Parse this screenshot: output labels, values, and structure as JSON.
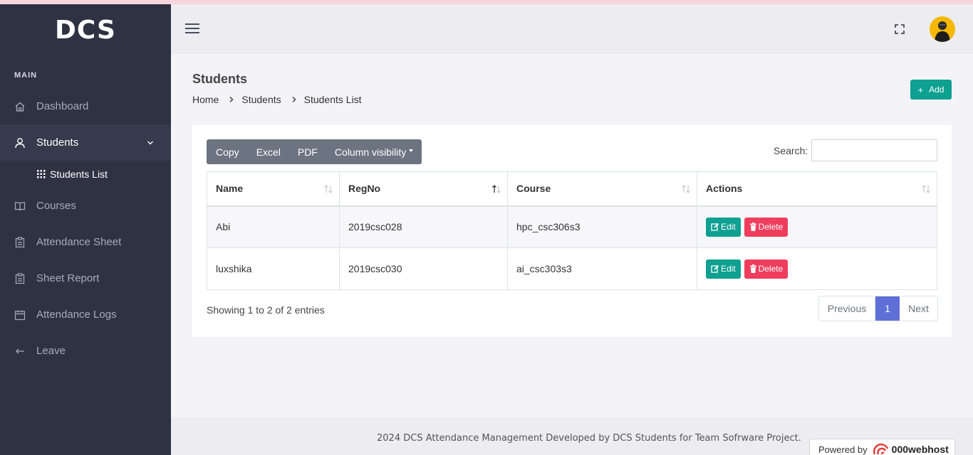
{
  "brand": "DCS",
  "sidebar": {
    "section_label": "MAIN",
    "items": [
      {
        "label": "Dashboard",
        "icon": "home-icon"
      },
      {
        "label": "Students",
        "icon": "user-icon"
      },
      {
        "label": "Courses",
        "icon": "book-icon"
      },
      {
        "label": "Attendance Sheet",
        "icon": "clipboard-icon"
      },
      {
        "label": "Sheet Report",
        "icon": "clipboard-icon"
      },
      {
        "label": "Attendance Logs",
        "icon": "calendar-icon"
      },
      {
        "label": "Leave",
        "icon": "arrow-left-icon"
      }
    ],
    "sub_item": "Students List"
  },
  "header": {
    "title": "Students",
    "breadcrumb": [
      "Home",
      "Students",
      "Students List"
    ],
    "add_label": "Add"
  },
  "toolbar": {
    "copy": "Copy",
    "excel": "Excel",
    "pdf": "PDF",
    "column_visibility": "Column visibility",
    "search_label": "Search:",
    "search_value": ""
  },
  "table": {
    "columns": [
      "Name",
      "RegNo",
      "Course",
      "Actions"
    ],
    "rows": [
      {
        "name": "Abi",
        "regno": "2019csc028",
        "course": "hpc_csc306s3"
      },
      {
        "name": "luxshika",
        "regno": "2019csc030",
        "course": "ai_csc303s3"
      }
    ],
    "edit_label": "Edit",
    "delete_label": "Delete"
  },
  "pagination": {
    "info": "Showing 1 to 2 of 2 entries",
    "previous": "Previous",
    "current": "1",
    "next": "Next"
  },
  "footer": {
    "text": "2024 DCS Attendance Management Developed by DCS Students for Team Sofrware Project.",
    "powered_by": "Powered by",
    "host_brand": "000webhost"
  },
  "colors": {
    "sidebar_bg": "#2e3243",
    "accent_green": "#0ea091",
    "delete_red": "#ef3d5e",
    "pager_active": "#5e6fd8"
  }
}
